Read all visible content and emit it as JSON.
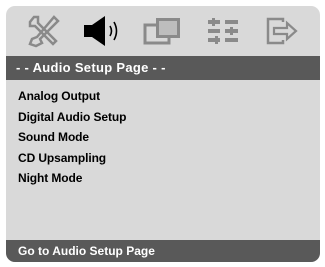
{
  "menu_bar": {
    "icons": [
      "tools-icon",
      "speaker-icon",
      "video-icon",
      "preferences-icon",
      "exit-icon"
    ]
  },
  "header": {
    "title": "- -   Audio Setup Page   - -"
  },
  "menu": {
    "items": [
      {
        "label": "Analog Output"
      },
      {
        "label": "Digital Audio Setup"
      },
      {
        "label": "Sound Mode"
      },
      {
        "label": "CD Upsampling"
      },
      {
        "label": "Night Mode"
      }
    ]
  },
  "status_bar": {
    "text": "Go to Audio Setup Page"
  },
  "colors": {
    "panel": "#d9d9d9",
    "bar": "#595959",
    "icon": "#8a8a8a",
    "icon_active": "#000000"
  }
}
